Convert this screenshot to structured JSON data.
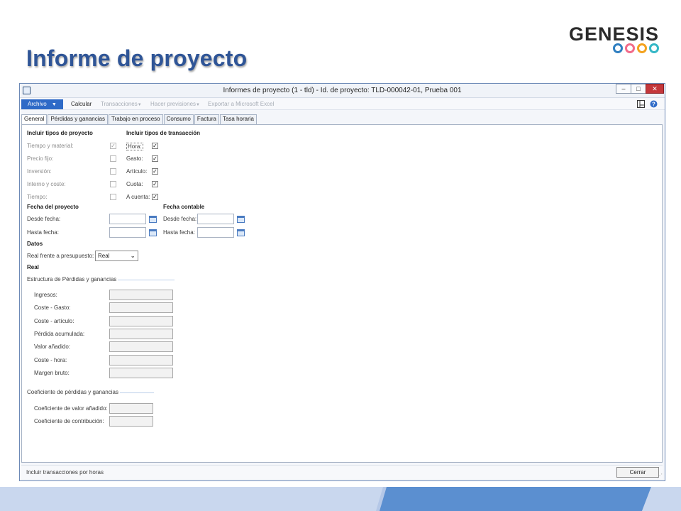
{
  "slide": {
    "title": "Informe de proyecto",
    "logo_text": "GENESIS",
    "logo_ring_colors": [
      "#2f7fc1",
      "#f26b8a",
      "#f3a21f",
      "#35b7c6"
    ]
  },
  "window": {
    "title": "Informes de proyecto (1 - tld) - Id. de proyecto: TLD-000042-01, Prueba 001",
    "controls": {
      "minimize": "–",
      "maximize": "□",
      "close": "✕"
    }
  },
  "toolbar": {
    "archivo": "Archivo",
    "calcular": "Calcular",
    "transacciones": "Transacciones",
    "hacer_previsiones": "Hacer previsiones",
    "exportar": "Exportar a Microsoft Excel"
  },
  "tabs": [
    "General",
    "Pérdidas y ganancias",
    "Trabajo en proceso",
    "Consumo",
    "Factura",
    "Tasa horaria"
  ],
  "general": {
    "project_types": {
      "heading": "Incluir tipos de proyecto",
      "items": [
        {
          "label": "Tiempo y material:",
          "checked": true
        },
        {
          "label": "Precio fijo:",
          "checked": false
        },
        {
          "label": "Inversión:",
          "checked": false
        },
        {
          "label": "Interno y coste:",
          "checked": false
        },
        {
          "label": "Tiempo:",
          "checked": false
        }
      ]
    },
    "transaction_types": {
      "heading": "Incluir tipos de transacción",
      "items": [
        {
          "label": "Hora:",
          "checked": true
        },
        {
          "label": "Gasto:",
          "checked": true
        },
        {
          "label": "Artículo:",
          "checked": true
        },
        {
          "label": "Cuota:",
          "checked": true
        },
        {
          "label": "A cuenta:",
          "checked": true
        }
      ]
    },
    "project_date": {
      "heading": "Fecha del proyecto",
      "from_label": "Desde fecha:",
      "to_label": "Hasta fecha:"
    },
    "accounting_date": {
      "heading": "Fecha contable",
      "from_label": "Desde fecha:",
      "to_label": "Hasta fecha:"
    },
    "data": {
      "heading": "Datos",
      "actual_vs_budget_label": "Real frente a presupuesto:",
      "actual_vs_budget_value": "Real"
    },
    "real_heading": "Real",
    "pl_structure": {
      "heading": "Estructura de Pérdidas y ganancias",
      "fields": [
        "Ingresos:",
        "Coste - Gasto:",
        "Coste - artículo:",
        "Pérdida acumulada:",
        "Valor añadido:",
        "Coste - hora:",
        "Margen bruto:"
      ]
    },
    "pl_ratio": {
      "heading": "Coeficiente de pérdidas y ganancias",
      "fields": [
        "Coeficiente de valor añadido:",
        "Coeficiente de contribución:"
      ]
    }
  },
  "status": {
    "text": "Incluir transacciones por horas",
    "close_button": "Cerrar"
  }
}
